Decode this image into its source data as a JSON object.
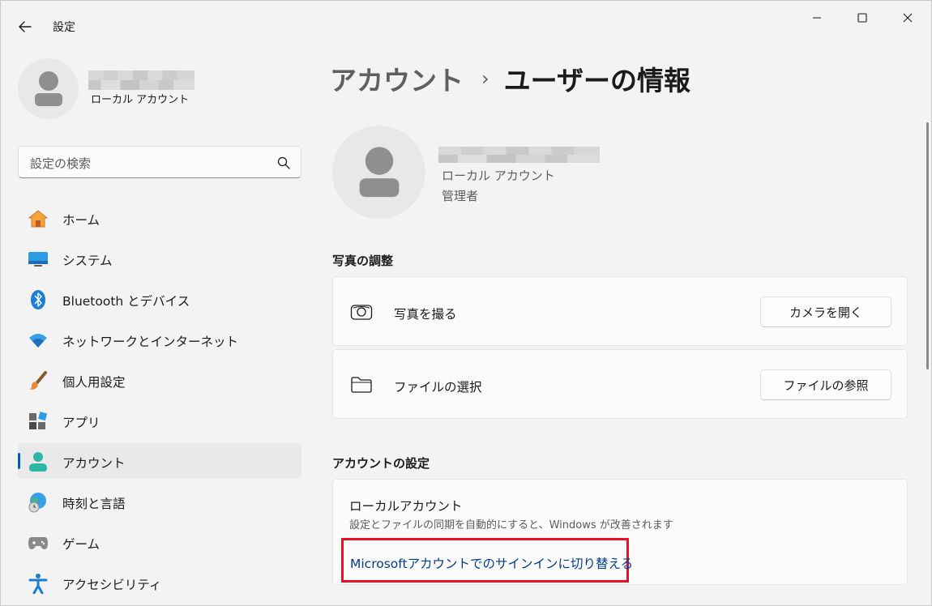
{
  "window": {
    "title": "設定",
    "controls": {
      "minimize": "minimize-icon",
      "maximize": "maximize-icon",
      "close": "close-icon"
    }
  },
  "sidebar": {
    "profile": {
      "account_type": "ローカル アカウント"
    },
    "search": {
      "placeholder": "設定の検索"
    },
    "items": [
      {
        "label": "ホーム",
        "icon": "home-icon",
        "selected": false
      },
      {
        "label": "システム",
        "icon": "system-icon",
        "selected": false
      },
      {
        "label": "Bluetooth とデバイス",
        "icon": "bluetooth-icon",
        "selected": false
      },
      {
        "label": "ネットワークとインターネット",
        "icon": "wifi-icon",
        "selected": false
      },
      {
        "label": "個人用設定",
        "icon": "brush-icon",
        "selected": false
      },
      {
        "label": "アプリ",
        "icon": "apps-icon",
        "selected": false
      },
      {
        "label": "アカウント",
        "icon": "account-icon",
        "selected": true
      },
      {
        "label": "時刻と言語",
        "icon": "time-language-icon",
        "selected": false
      },
      {
        "label": "ゲーム",
        "icon": "gamepad-icon",
        "selected": false
      },
      {
        "label": "アクセシビリティ",
        "icon": "accessibility-icon",
        "selected": false
      }
    ]
  },
  "main": {
    "breadcrumb": {
      "parent": "アカウント",
      "separator": "›",
      "current": "ユーザーの情報"
    },
    "user": {
      "account_type": "ローカル アカウント",
      "role": "管理者"
    },
    "photo_section": {
      "title": "写真の調整",
      "take_photo": {
        "label": "写真を撮る",
        "button": "カメラを開く"
      },
      "choose_file": {
        "label": "ファイルの選択",
        "button": "ファイルの参照"
      }
    },
    "account_section": {
      "title": "アカウントの設定",
      "local": {
        "title": "ローカルアカウント",
        "description": "設定とファイルの同期を自動的にすると、Windows が改善されます",
        "link": "Microsoftアカウントでのサインインに切り替える"
      }
    }
  },
  "colors": {
    "accent": "#005fb8",
    "link": "#003e92",
    "highlight": "#e81123"
  }
}
